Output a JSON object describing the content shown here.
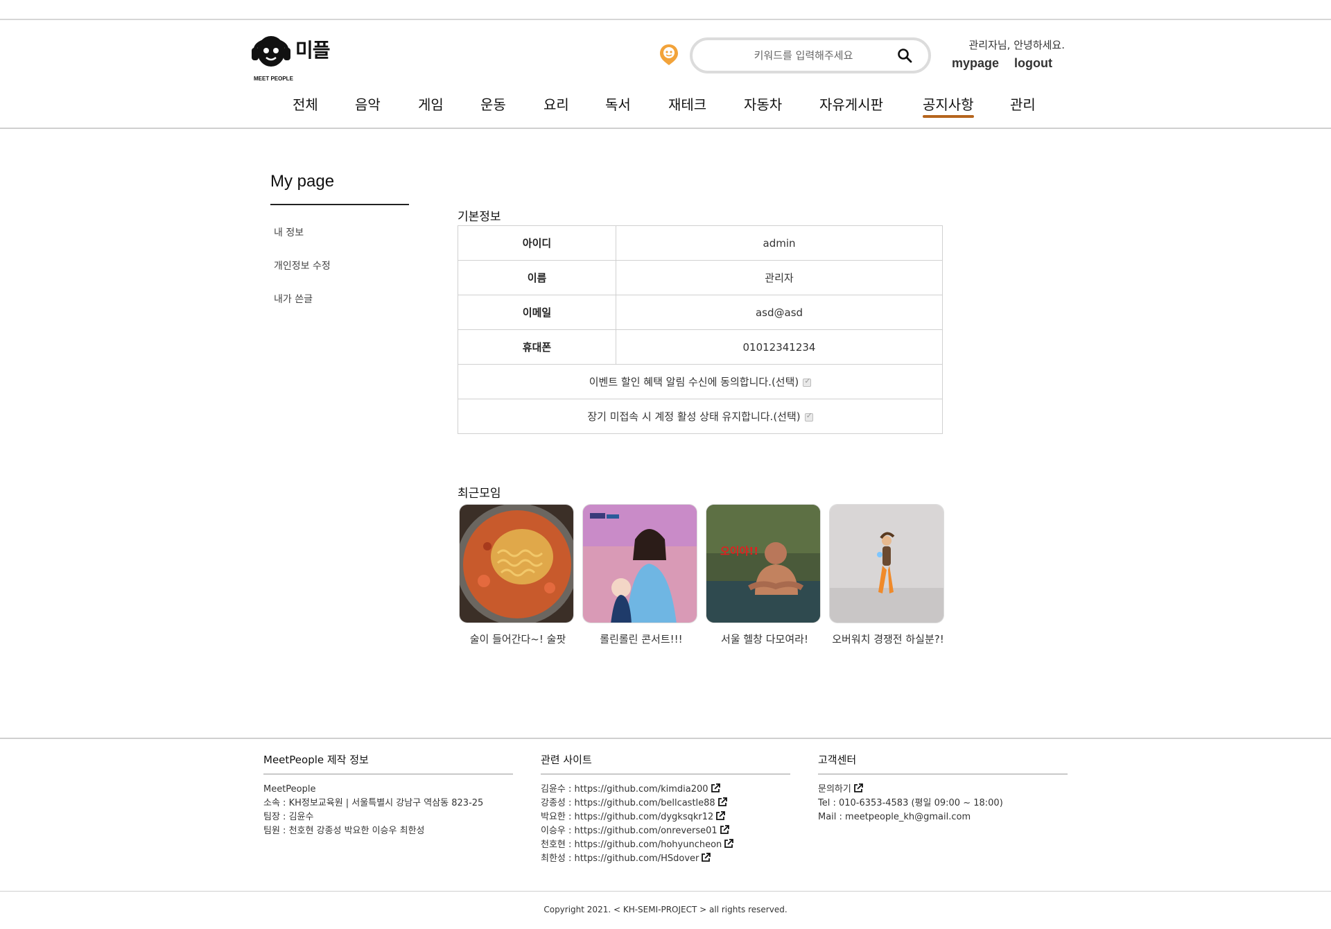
{
  "header": {
    "logo_text": "미플",
    "logo_sub": "MEET PEOPLE",
    "search_placeholder": "키워드를 입력해주세요",
    "greeting": "관리자님, 안녕하세요.",
    "mypage_label": "mypage",
    "logout_label": "logout",
    "accent_color": "#b5651d"
  },
  "nav": {
    "items": [
      "전체",
      "음악",
      "게임",
      "운동",
      "요리",
      "독서",
      "재테크",
      "자동차",
      "자유게시판",
      "공지사항",
      "관리"
    ],
    "active": "공지사항"
  },
  "sidebar": {
    "title": "My page",
    "items": [
      "내 정보",
      "개인정보 수정",
      "내가 쓴글"
    ]
  },
  "basic_info": {
    "title": "기본정보",
    "rows": [
      {
        "key": "아이디",
        "value": "admin"
      },
      {
        "key": "이름",
        "value": "관리자"
      },
      {
        "key": "이메일",
        "value": "asd@asd"
      },
      {
        "key": "휴대폰",
        "value": "01012341234"
      }
    ],
    "consent_event": "이벤트 할인 혜택 알림 수신에 동의합니다.(선택)",
    "consent_keep": "장기 미접속 시 계정 활성 상태 유지합니다.(선택)"
  },
  "recent": {
    "title": "최근모임",
    "items": [
      {
        "label": "술이 들어간다~! 술팟"
      },
      {
        "label": "롤린롤린 콘서트!!!"
      },
      {
        "label": "서울 헬창 다모여라!"
      },
      {
        "label": "오버워치 경쟁전 하실분?!"
      }
    ]
  },
  "footer": {
    "col1": {
      "title": "MeetPeople 제작 정보",
      "lines": [
        "MeetPeople",
        "소속 : KH정보교육원 | 서울특별시 강남구 역삼동 823-25",
        "팀장 : 김윤수",
        "팀원 : 천호현 강종성 박요한 이승우 최한성"
      ]
    },
    "col2": {
      "title": "관련 사이트",
      "links": [
        {
          "name": "김윤수 : ",
          "url": "https://github.com/kimdia200"
        },
        {
          "name": "강종성 : ",
          "url": "https://github.com/bellcastle88"
        },
        {
          "name": "박요한 : ",
          "url": "https://github.com/dygksqkr12"
        },
        {
          "name": "이승우 : ",
          "url": "https://github.com/onreverse01"
        },
        {
          "name": "천호현 : ",
          "url": "https://github.com/hohyuncheon"
        },
        {
          "name": "최한성 : ",
          "url": "https://github.com/HSdover"
        }
      ]
    },
    "col3": {
      "title": "고객센터",
      "contact_label": "문의하기",
      "tel": "Tel : 010-6353-4583 (평일 09:00 ~ 18:00)",
      "mail": "Mail : meetpeople_kh@gmail.com"
    },
    "copyright": "Copyright 2021. < KH-SEMI-PROJECT > all rights reserved."
  }
}
